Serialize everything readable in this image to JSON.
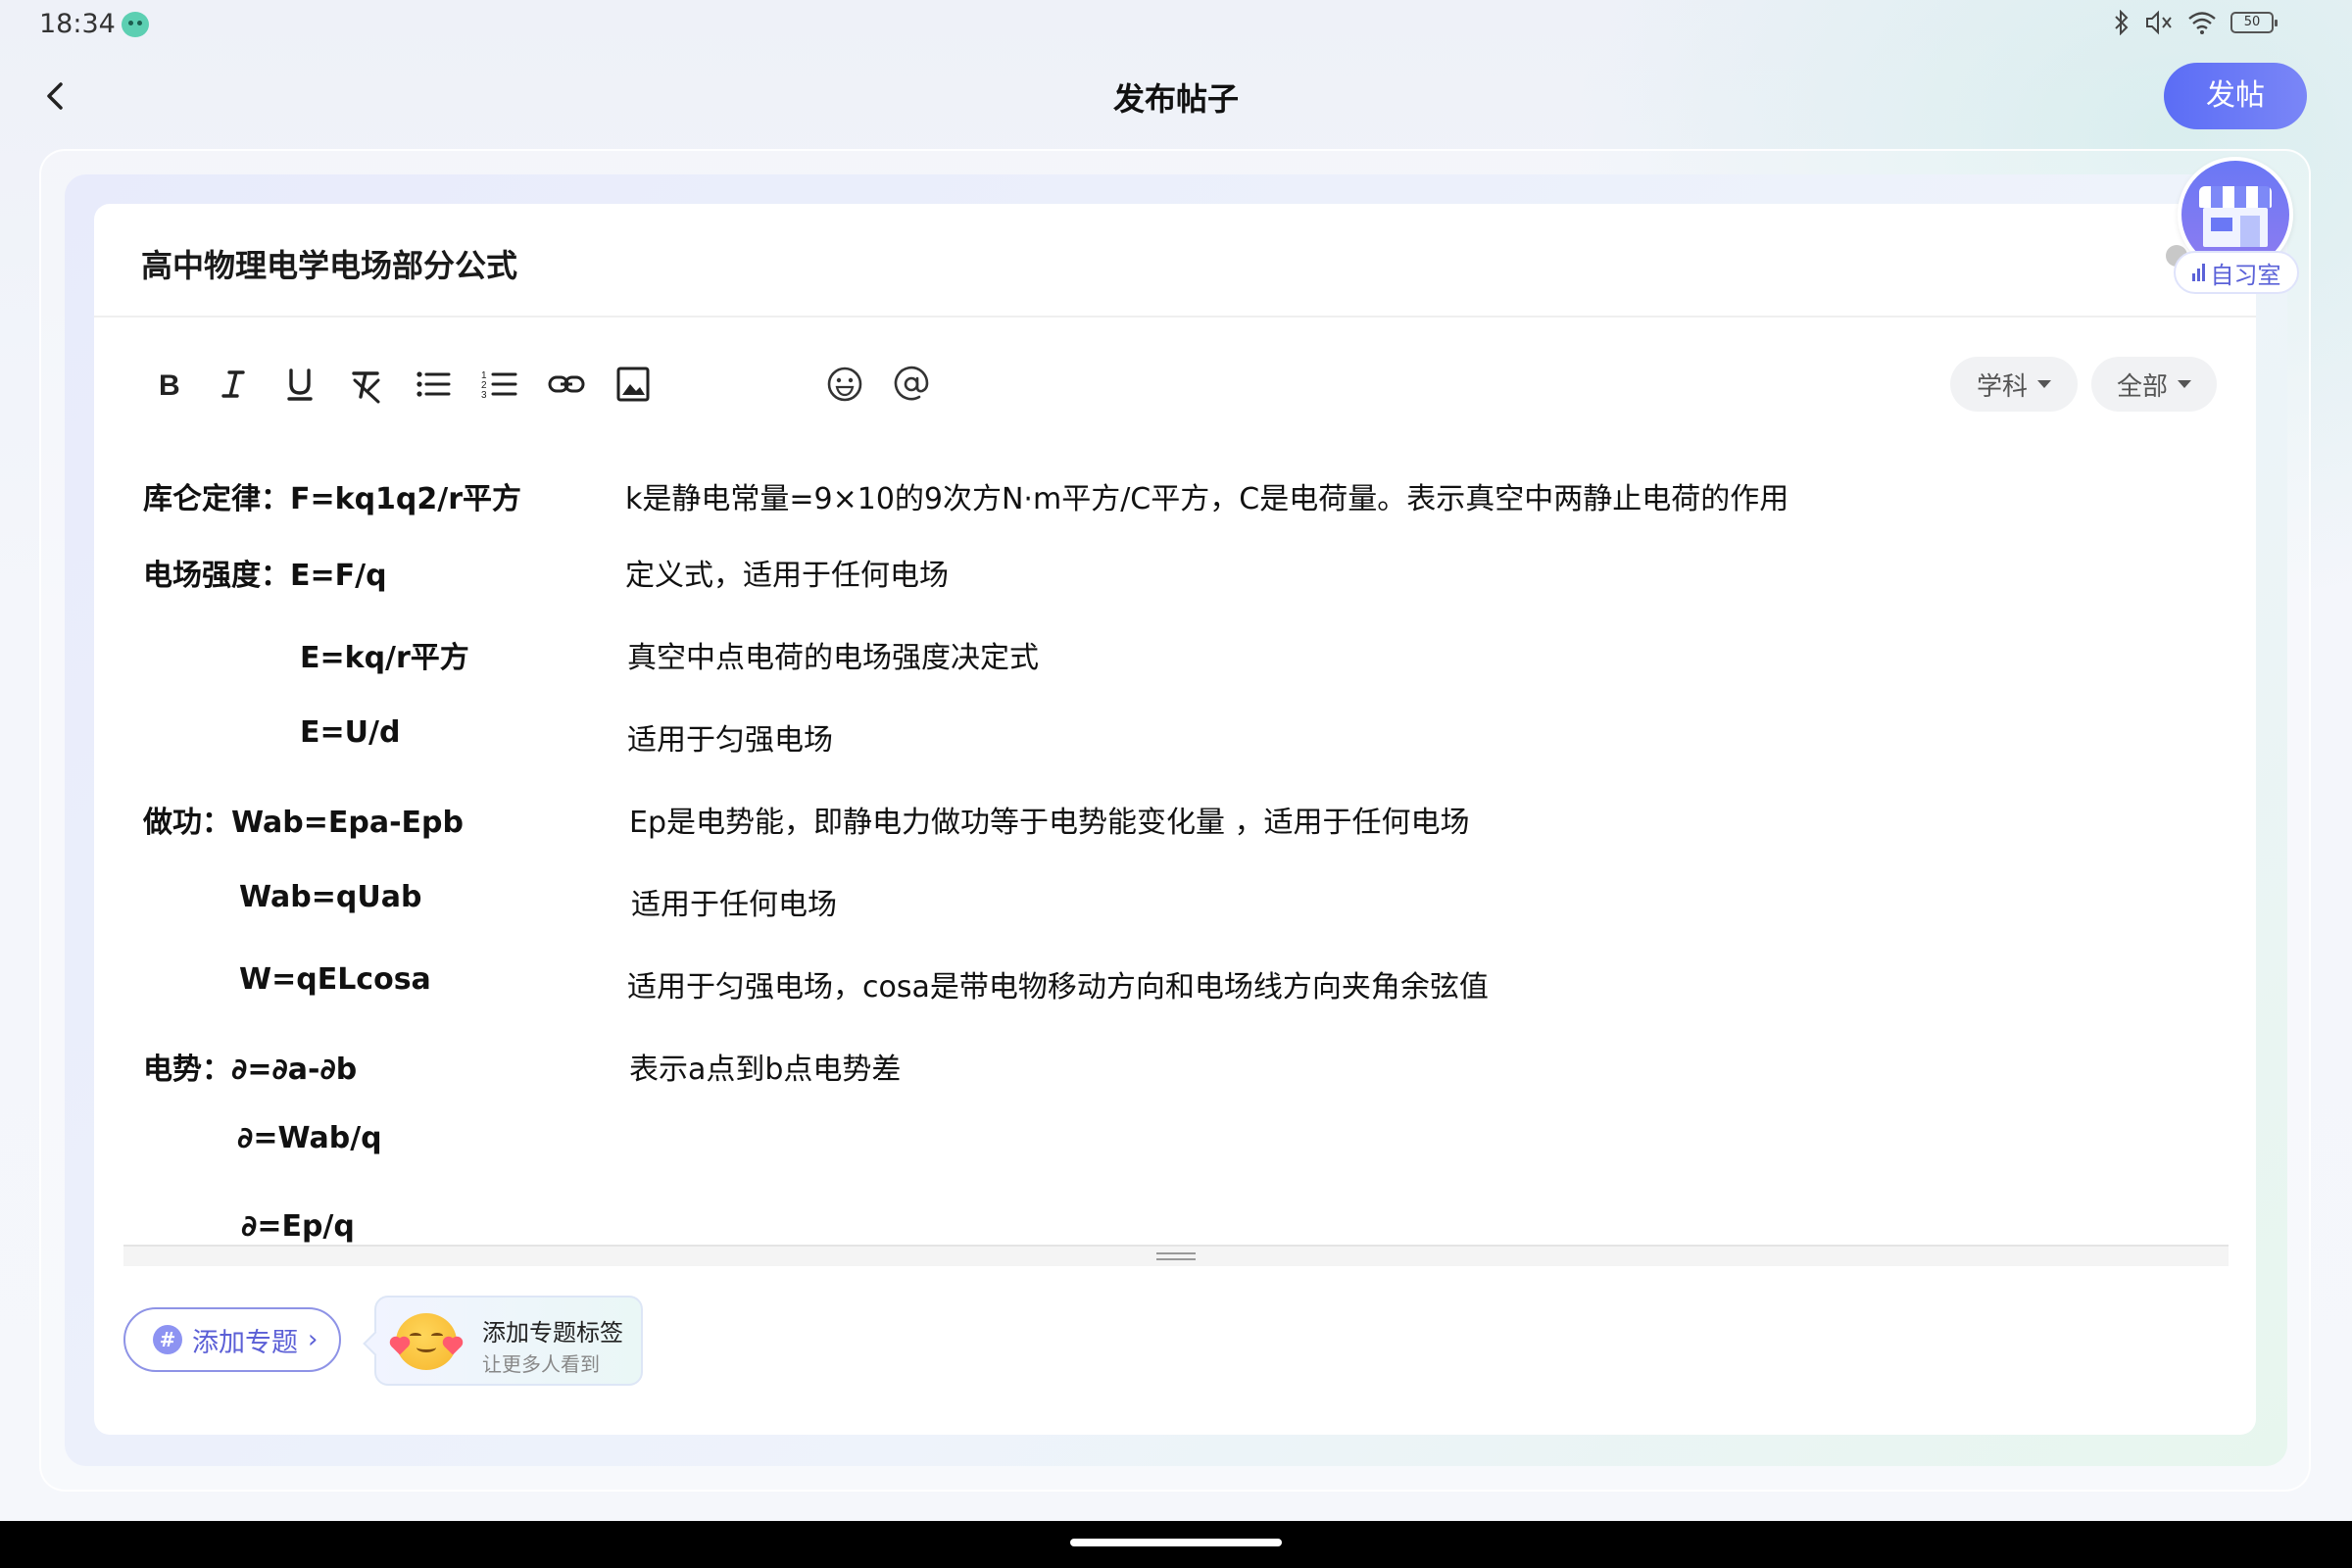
{
  "status_bar": {
    "time": "18:34",
    "battery": "50",
    "icons": [
      "bluetooth-icon",
      "mute-icon",
      "wifi-icon",
      "battery-icon"
    ]
  },
  "header": {
    "title": "发布帖子",
    "publish_label": "发帖",
    "accent_color": "#5b6df5"
  },
  "study_room": {
    "label": "自习室"
  },
  "post": {
    "title": "高中物理电学电场部分公式"
  },
  "toolbar": {
    "icons": [
      "bold-icon",
      "italic-icon",
      "underline-icon",
      "clear-format-icon",
      "bullet-list-icon",
      "numbered-list-icon",
      "link-icon",
      "image-icon",
      "emoji-icon",
      "mention-icon"
    ],
    "subject_select": "学科",
    "scope_select": "全部"
  },
  "content": {
    "rows": [
      {
        "formula": "库仑定律：F=kq1q2/r平方",
        "note": "k是静电常量=9×10的9次方N·m平方/C平方，C是电荷量。表示真空中两静止电荷的作用"
      },
      {
        "formula": "电场强度：E=F/q",
        "note": "定义式，适用于任何电场"
      },
      {
        "formula": "E=kq/r平方",
        "note": "真空中点电荷的电场强度决定式"
      },
      {
        "formula": "E=U/d",
        "note": "适用于匀强电场"
      },
      {
        "formula": "做功：Wab=Epa-Epb",
        "note": "Ep是电势能，即静电力做功等于电势能变化量 ，适用于任何电场"
      },
      {
        "formula": "Wab=qUab",
        "note": "适用于任何电场"
      },
      {
        "formula": "W=qELcosa",
        "note": "适用于匀强电场，cosa是带电物移动方向和电场线方向夹角余弦值"
      },
      {
        "formula": "电势：∂=∂a-∂b",
        "note": "表示a点到b点电势差"
      },
      {
        "formula": "∂=Wab/q",
        "note": ""
      },
      {
        "formula": "∂=Ep/q",
        "note": ""
      }
    ]
  },
  "footer": {
    "add_topic_label": "添加专题",
    "tip_title": "添加专题标签",
    "tip_subtitle": "让更多人看到"
  }
}
